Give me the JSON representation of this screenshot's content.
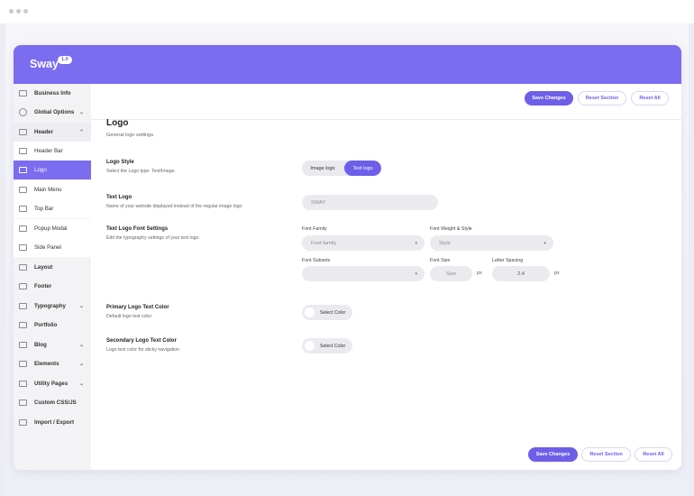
{
  "brand": {
    "name": "Sway",
    "version": "1.0"
  },
  "sidebar": {
    "items": [
      {
        "label": "Business Info",
        "icon": "business-info-icon"
      },
      {
        "label": "Global Options",
        "icon": "global-options-icon",
        "chevron": "⌄"
      },
      {
        "label": "Header",
        "icon": "header-icon",
        "chevron": "⌃"
      },
      {
        "label": "Header Bar",
        "icon": "header-bar-icon"
      },
      {
        "label": "Logo",
        "icon": "logo-icon"
      },
      {
        "label": "Main Menu",
        "icon": "main-menu-icon"
      },
      {
        "label": "Top Bar",
        "icon": "top-bar-icon"
      },
      {
        "label": "Popup Modal",
        "icon": "popup-modal-icon"
      },
      {
        "label": "Side Panel",
        "icon": "side-panel-icon"
      },
      {
        "label": "Layout",
        "icon": "layout-icon"
      },
      {
        "label": "Footer",
        "icon": "footer-icon"
      },
      {
        "label": "Typography",
        "icon": "typography-icon",
        "chevron": "⌄"
      },
      {
        "label": "Portfolio",
        "icon": "portfolio-icon"
      },
      {
        "label": "Blog",
        "icon": "blog-icon",
        "chevron": "⌄"
      },
      {
        "label": "Elements",
        "icon": "elements-icon",
        "chevron": "⌄"
      },
      {
        "label": "Utility Pages",
        "icon": "utility-pages-icon",
        "chevron": "⌄"
      },
      {
        "label": "Custom CSS/JS",
        "icon": "code-icon"
      },
      {
        "label": "Import / Export",
        "icon": "import-export-icon"
      }
    ]
  },
  "toolbar": {
    "save_label": "Save Changes",
    "reset_section_label": "Reset Section",
    "reset_all_label": "Reset All"
  },
  "section": {
    "title": "Logo",
    "subtitle": "General logo settings."
  },
  "logo_style": {
    "label": "Logo Style",
    "desc": "Select the Logo type: Text/Image.",
    "options": [
      "Image logo",
      "Text logo"
    ],
    "selected": "Text logo"
  },
  "text_logo": {
    "label": "Text Logo",
    "desc": "Name of your website displayed instead of the regular image logo",
    "value": "SWAY"
  },
  "font_settings": {
    "label": "Text Logo Font Settings",
    "desc": "Edit the typography settings of your text logo.",
    "font_family_label": "Font Family",
    "font_family_placeholder": "Font family",
    "font_weight_label": "Font Weight & Style",
    "font_weight_placeholder": "Style",
    "font_subsets_label": "Font Subsets",
    "font_size_label": "Font Size",
    "font_size_placeholder": "Size",
    "letter_spacing_label": "Letter Spacing",
    "letter_spacing_value": "2.4",
    "unit": "px"
  },
  "primary_color": {
    "label": "Primary Logo Text Color",
    "desc": "Default logo text color",
    "button": "Select Color"
  },
  "secondary_color": {
    "label": "Secondary Logo Text Color",
    "desc": "Logo text color for sticky navigation",
    "button": "Select Color"
  },
  "colors": {
    "accent": "#6e5fe8",
    "header": "#7b6cf0",
    "sidebar": "#f3f3f5"
  }
}
